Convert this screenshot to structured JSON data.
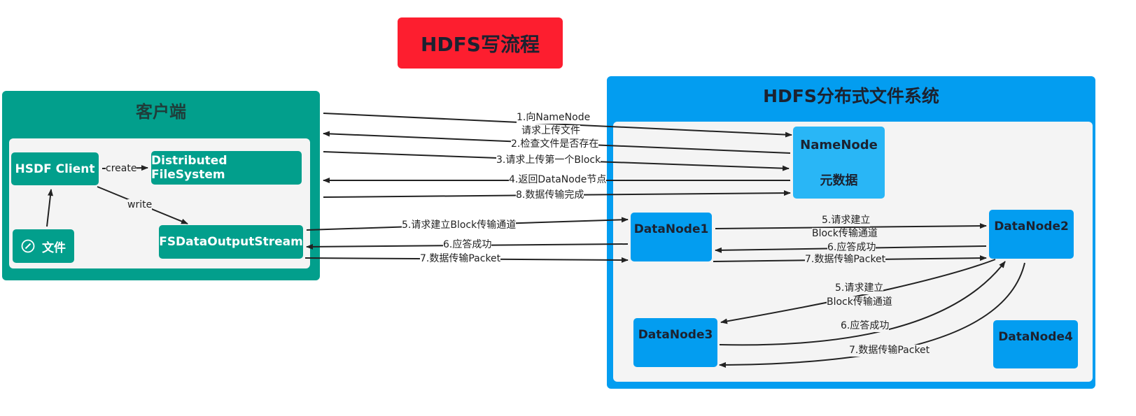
{
  "title": "HDFS写流程",
  "client": {
    "title": "客户端",
    "hsdf_client": "HSDF Client",
    "distributed_fs": "Distributed FileSystem",
    "file": "文件",
    "output_stream": "FSDataOutputStream",
    "create_label": "create",
    "write_label": "write"
  },
  "hdfs": {
    "title": "HDFS分布式文件系统",
    "namenode": "NameNode",
    "metadata": "元数据",
    "datanode1": "DataNode1",
    "datanode2": "DataNode2",
    "datanode3": "DataNode3",
    "datanode4": "DataNode4"
  },
  "steps": {
    "s1_line1": "1.向NameNode",
    "s1_line2": "请求上传文件",
    "s2": "2.检查文件是否存在",
    "s3": "3.请求上传第一个Block",
    "s4": "4.返回DataNode节点",
    "s8": "8.数据传输完成",
    "s5_client": "5.请求建立Block传输通道",
    "s6_client": "6.应答成功",
    "s7_client": "7.数据传输Packet",
    "s5_dn12_line1": "5.请求建立",
    "s5_dn12_line2": "Block传输通道",
    "s6_dn12": "6.应答成功",
    "s7_dn12": "7.数据传输Packet",
    "s5_dn23_line1": "5.请求建立",
    "s5_dn23_line2": "Block传输通道",
    "s6_dn23": "6.应答成功",
    "s7_dn23": "7.数据传输Packet"
  },
  "colors": {
    "title_red": "#fd1e2f",
    "client_teal": "#029f8c",
    "hdfs_blue": "#039df0",
    "namenode_light_blue": "#29b6f6",
    "inner_gray": "#f4f4f4"
  }
}
